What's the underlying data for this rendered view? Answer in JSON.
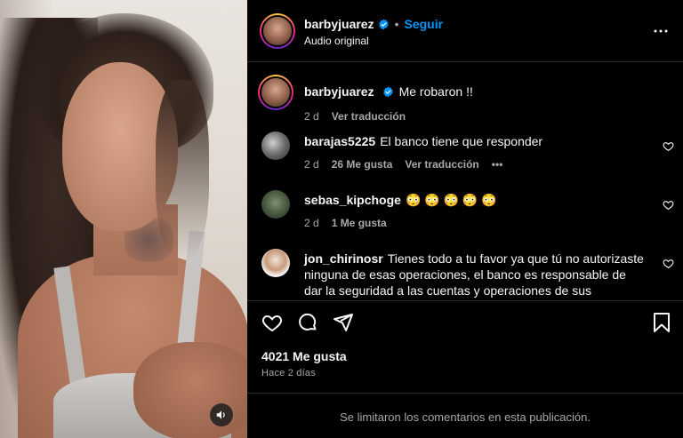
{
  "post": {
    "author": "barbyjuarez",
    "separator": "•",
    "follow_label": "Seguir",
    "audio": "Audio original"
  },
  "caption": {
    "author": "barbyjuarez",
    "text": "Me robaron !!",
    "time": "2 d",
    "translate": "Ver traducción"
  },
  "comments": [
    {
      "author": "barajas5225",
      "text": "El banco tiene que responder",
      "time": "2 d",
      "likes": "26 Me gusta",
      "translate": "Ver traducción",
      "more": "•••"
    },
    {
      "author": "sebas_kipchoge",
      "text": "😳 😳 😳 😳 😳",
      "time": "2 d",
      "likes": "1 Me gusta"
    },
    {
      "author": "jon_chirinosr",
      "text": "Tienes todo a tu favor ya que tú no autorizaste ninguna de esas operaciones, el banco es responsable de dar la seguridad a las cuentas y operaciones de sus"
    }
  ],
  "footer": {
    "likes": "4021 Me gusta",
    "ago": "Hace 2 días",
    "limited_notice": "Se limitaron los comentarios en esta publicación."
  },
  "icons": {
    "verified": "verified-badge-icon",
    "more": "more-options-icon",
    "like": "heart-icon",
    "comment": "comment-icon",
    "share": "share-icon",
    "save": "bookmark-icon",
    "mute": "speaker-icon"
  },
  "colors": {
    "accent": "#0095f6",
    "background": "#000000",
    "secondary_text": "#a8a8a8"
  }
}
